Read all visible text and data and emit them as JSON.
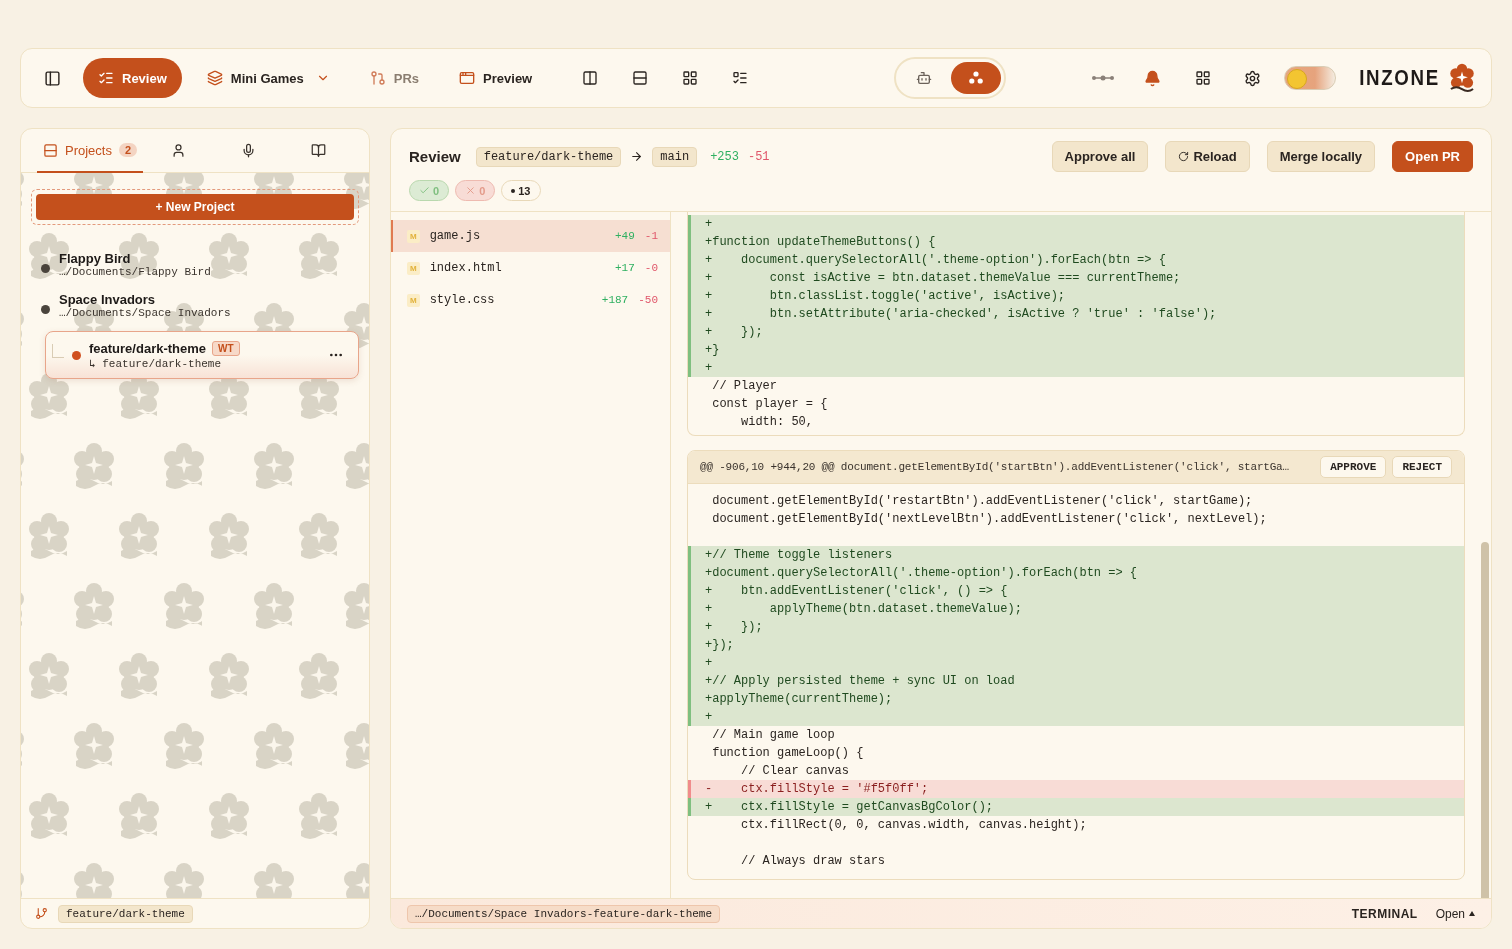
{
  "toolbar": {
    "tabs": [
      {
        "label": "Review",
        "selected": true
      },
      {
        "label": "Mini Games",
        "selected": false,
        "dropdown": true
      },
      {
        "label": "PRs",
        "selected": false,
        "disabled": true
      },
      {
        "label": "Preview",
        "selected": false
      }
    ],
    "mode_switch": [
      {
        "selected": false
      },
      {
        "selected": true
      }
    ],
    "notifications_active": true,
    "theme_toggle": {
      "on": false
    },
    "logo": "INZONE"
  },
  "sidebar": {
    "tabs": [
      {
        "label": "Projects",
        "count": "2",
        "selected": true
      },
      {
        "selected": false
      },
      {
        "selected": false
      },
      {
        "selected": false
      }
    ],
    "new_project": "+ New Project",
    "projects": [
      {
        "name": "Flappy Bird",
        "path": "…/Documents/Flappy Bird",
        "color": "#4a443c"
      },
      {
        "name": "Space Invadors",
        "path": "…/Documents/Space Invadors",
        "color": "#4a443c",
        "children": [
          {
            "name": "feature/dark-theme",
            "badge": "WT",
            "branch": "↳ feature/dark-theme",
            "color": "#d0501f",
            "selected": true
          }
        ]
      }
    ],
    "footer_branch": "feature/dark-theme"
  },
  "review": {
    "title": "Review",
    "source_branch": "feature/dark-theme",
    "target_branch": "main",
    "added": "+253",
    "removed": "-51",
    "buttons": [
      {
        "label": "Approve all",
        "kind": "secondary"
      },
      {
        "label": "Reload",
        "kind": "reload"
      },
      {
        "label": "Merge locally",
        "kind": "secondary"
      },
      {
        "label": "Open PR",
        "kind": "primary"
      }
    ],
    "counters": [
      {
        "kind": "approved",
        "count": "0"
      },
      {
        "kind": "rejected",
        "count": "0"
      },
      {
        "kind": "pending",
        "count": "13"
      }
    ],
    "files": [
      {
        "status": "M",
        "name": "game.js",
        "added": "+49",
        "removed": "-1",
        "selected": true
      },
      {
        "status": "M",
        "name": "index.html",
        "added": "+17",
        "removed": "-0",
        "selected": false
      },
      {
        "status": "M",
        "name": "style.css",
        "added": "+187",
        "removed": "-50",
        "selected": false
      }
    ],
    "hunks": [
      {
        "lines": [
          {
            "kind": "add",
            "text": "+"
          },
          {
            "kind": "add",
            "text": "+function updateThemeButtons() {"
          },
          {
            "kind": "add",
            "text": "+    document.querySelectorAll('.theme-option').forEach(btn => {"
          },
          {
            "kind": "add",
            "text": "+        const isActive = btn.dataset.themeValue === currentTheme;"
          },
          {
            "kind": "add",
            "text": "+        btn.classList.toggle('active', isActive);"
          },
          {
            "kind": "add",
            "text": "+        btn.setAttribute('aria-checked', isActive ? 'true' : 'false');"
          },
          {
            "kind": "add",
            "text": "+    });"
          },
          {
            "kind": "add",
            "text": "+}"
          },
          {
            "kind": "add",
            "text": "+"
          },
          {
            "kind": "context",
            "text": " // Player"
          },
          {
            "kind": "context",
            "text": " const player = {"
          },
          {
            "kind": "context",
            "text": "     width: 50,"
          }
        ]
      },
      {
        "header": "@@ -906,10 +944,20 @@ document.getElementById('startBtn').addEventListener('click', startGa…",
        "actions": [
          "APPROVE",
          "REJECT"
        ],
        "lines": [
          {
            "kind": "context",
            "text": " document.getElementById('restartBtn').addEventListener('click', startGame);"
          },
          {
            "kind": "context",
            "text": " document.getElementById('nextLevelBtn').addEventListener('click', nextLevel);"
          },
          {
            "kind": "blank"
          },
          {
            "kind": "add",
            "text": "+// Theme toggle listeners"
          },
          {
            "kind": "add",
            "text": "+document.querySelectorAll('.theme-option').forEach(btn => {"
          },
          {
            "kind": "add",
            "text": "+    btn.addEventListener('click', () => {"
          },
          {
            "kind": "add",
            "text": "+        applyTheme(btn.dataset.themeValue);"
          },
          {
            "kind": "add",
            "text": "+    });"
          },
          {
            "kind": "add",
            "text": "+});"
          },
          {
            "kind": "add",
            "text": "+"
          },
          {
            "kind": "add",
            "text": "+// Apply persisted theme + sync UI on load"
          },
          {
            "kind": "add",
            "text": "+applyTheme(currentTheme);"
          },
          {
            "kind": "add",
            "text": "+"
          },
          {
            "kind": "context",
            "text": " // Main game loop"
          },
          {
            "kind": "context",
            "text": " function gameLoop() {"
          },
          {
            "kind": "context",
            "text": "     // Clear canvas"
          },
          {
            "kind": "del",
            "text": "-    ctx.fillStyle = '#f5f0ff';"
          },
          {
            "kind": "add",
            "text": "+    ctx.fillStyle = getCanvasBgColor();"
          },
          {
            "kind": "context",
            "text": "     ctx.fillRect(0, 0, canvas.width, canvas.height);"
          },
          {
            "kind": "blank"
          },
          {
            "kind": "context",
            "text": "     // Always draw stars"
          }
        ]
      }
    ]
  },
  "status_bar": {
    "path": "…/Documents/Space Invadors-feature-dark-theme",
    "terminal": "TERMINAL",
    "open": "Open"
  }
}
